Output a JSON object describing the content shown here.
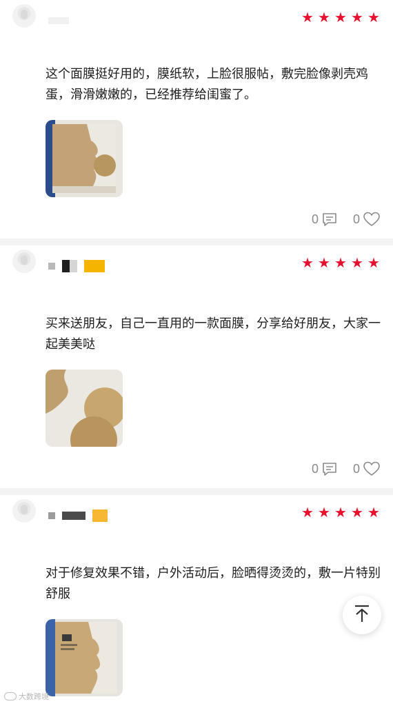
{
  "reviews": [
    {
      "rating": 5,
      "content": "这个面膜挺好用的，膜纸软，上脸很服帖，敷完脸像剥壳鸡蛋，滑滑嫩嫩的，已经推荐给闺蜜了。",
      "comment_count": "0",
      "like_count": "0",
      "image": "product-photo-mask-box"
    },
    {
      "rating": 5,
      "content": "买来送朋友，自己一直用的一款面膜，分享给好朋友，大家一起美美哒",
      "comment_count": "0",
      "like_count": "0",
      "image": "product-photo-mask-closeup"
    },
    {
      "rating": 5,
      "content": "对于修复效果不错，户外活动后，脸晒得烫烫的，敷一片特别舒服",
      "image": "product-photo-mask-package"
    }
  ],
  "icons": {
    "star": "star-icon",
    "comment": "comment-icon",
    "like": "heart-icon",
    "back_to_top": "arrow-up-icon"
  },
  "colors": {
    "star": "#e8112d",
    "meta_text": "#8a8a8a",
    "divider": "#f3f3f3"
  },
  "watermark": {
    "text": "大数跨境"
  }
}
